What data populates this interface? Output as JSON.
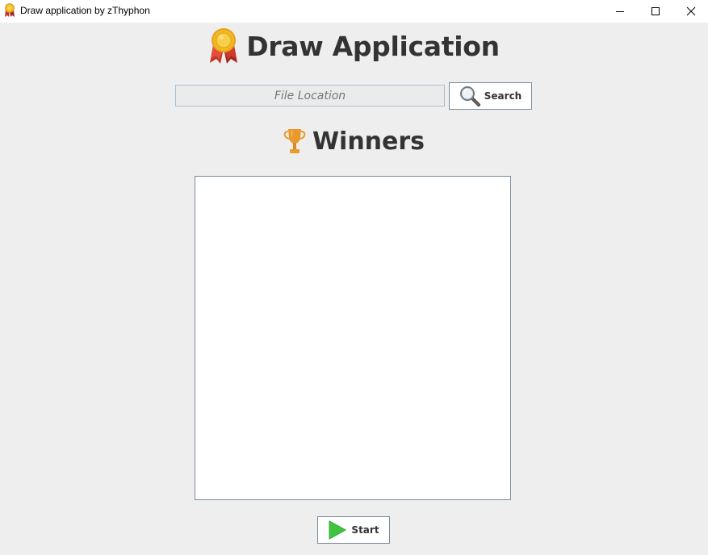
{
  "window": {
    "title": "Draw application by zThyphon",
    "app_icon": "medal-icon",
    "controls": {
      "minimize_icon": "minimize-icon",
      "maximize_icon": "maximize-icon",
      "close_icon": "close-icon"
    }
  },
  "header": {
    "title": "Draw Application",
    "icon": "medal-icon"
  },
  "file": {
    "placeholder": "File Location",
    "value": ""
  },
  "search_button": {
    "label": "Search",
    "icon": "magnifier-icon"
  },
  "winners": {
    "title": "Winners",
    "icon": "trophy-icon",
    "items": []
  },
  "start_button": {
    "label": "Start",
    "icon": "play-icon"
  },
  "colors": {
    "background": "#eeeeee",
    "heading_text": "#333333",
    "field_border": "#a9bfd6",
    "button_border": "#7a8a99",
    "play_green": "#3fc43f",
    "trophy_orange": "#e89a2c",
    "medal_gold": "#f2b824",
    "medal_ribbon": "#c0392b"
  }
}
